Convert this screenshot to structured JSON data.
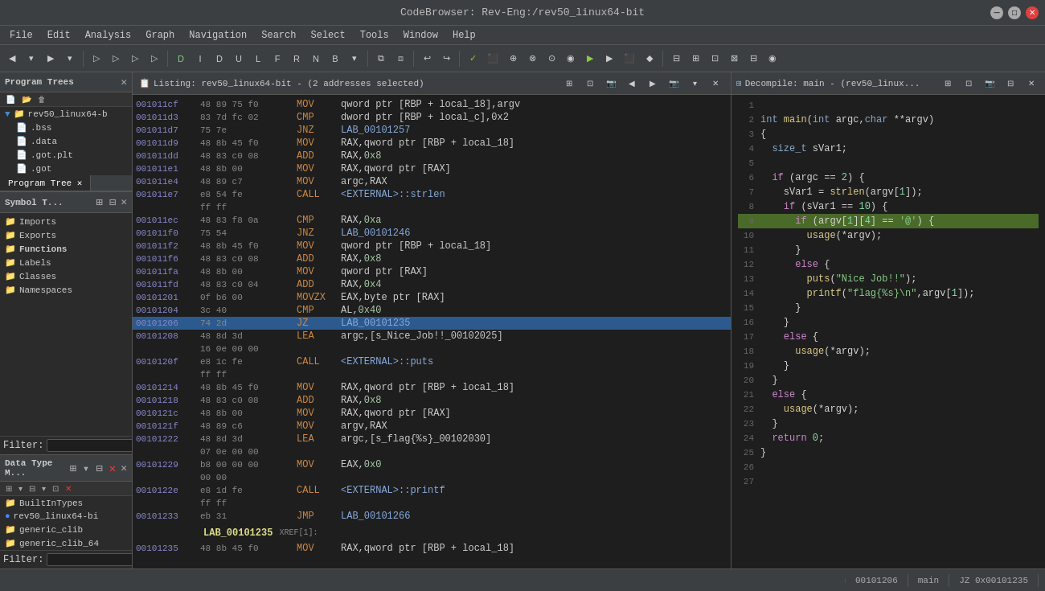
{
  "titleBar": {
    "title": "CodeBrowser: Rev-Eng:/rev50_linux64-bit"
  },
  "menuBar": {
    "items": [
      "File",
      "Edit",
      "Analysis",
      "Graph",
      "Navigation",
      "Search",
      "Select",
      "Tools",
      "Window",
      "Help"
    ]
  },
  "programTrees": {
    "title": "Program Trees",
    "tabs": [
      {
        "label": "Program Tree",
        "active": true
      }
    ],
    "tree": [
      {
        "label": "rev50_linux64-b",
        "level": 1,
        "icon": "▼",
        "hasChildren": true
      },
      {
        "label": ".bss",
        "level": 2,
        "icon": "📄"
      },
      {
        "label": ".data",
        "level": 2,
        "icon": "📄"
      },
      {
        "label": ".got.plt",
        "level": 2,
        "icon": "📄"
      },
      {
        "label": ".got",
        "level": 2,
        "icon": "📄"
      }
    ]
  },
  "symbolTree": {
    "title": "Symbol T...",
    "items": [
      {
        "label": "Imports",
        "icon": "📁",
        "level": 1
      },
      {
        "label": "Exports",
        "icon": "📁",
        "level": 1
      },
      {
        "label": "Functions",
        "icon": "📁",
        "level": 1,
        "bold": true
      },
      {
        "label": "Labels",
        "icon": "📁",
        "level": 1
      },
      {
        "label": "Classes",
        "icon": "📁",
        "level": 1
      },
      {
        "label": "Namespaces",
        "icon": "📁",
        "level": 1
      }
    ],
    "filter": ""
  },
  "dataTypeManager": {
    "title": "Data Type M...",
    "items": [
      {
        "label": "BuiltInTypes",
        "icon": "📁"
      },
      {
        "label": "rev50_linux64-bi",
        "icon": "🔵"
      },
      {
        "label": "generic_clib",
        "icon": "📁"
      },
      {
        "label": "generic_clib_64",
        "icon": "📁"
      }
    ],
    "filter": ""
  },
  "listing": {
    "title": "Listing:  rev50_linux64-bit - (2 addresses selected)",
    "rows": [
      {
        "addr": "001011cf",
        "bytes": "48 89 75 f0",
        "mnem": "MOV",
        "ops": "qword ptr [RBP + local_18],argv",
        "highlight": ""
      },
      {
        "addr": "001011d3",
        "bytes": "83 7d fc 02",
        "mnem": "CMP",
        "ops": "dword ptr [RBP + local_c],0x2",
        "highlight": ""
      },
      {
        "addr": "001011d7",
        "bytes": "75 7e",
        "mnem": "JNZ",
        "ops": "LAB_00101257",
        "highlight": ""
      },
      {
        "addr": "001011d9",
        "bytes": "48 8b 45 f0",
        "mnem": "MOV",
        "ops": "RAX,qword ptr [RBP + local_18]",
        "highlight": ""
      },
      {
        "addr": "001011dd",
        "bytes": "48 83 c0 08",
        "mnem": "ADD",
        "ops": "RAX,0x8",
        "highlight": ""
      },
      {
        "addr": "001011e1",
        "bytes": "48 8b 00",
        "mnem": "MOV",
        "ops": "RAX,qword ptr [RAX]",
        "highlight": ""
      },
      {
        "addr": "001011e4",
        "bytes": "48 89 c7",
        "mnem": "MOV",
        "ops": "argc,RAX",
        "highlight": ""
      },
      {
        "addr": "001011e7",
        "bytes": "e8 54 fe",
        "mnem": "CALL",
        "ops": "<EXTERNAL>::strlen",
        "highlight": ""
      },
      {
        "addr": "",
        "bytes": "ff ff",
        "mnem": "",
        "ops": "",
        "highlight": ""
      },
      {
        "addr": "001011ec",
        "bytes": "48 83 f8 0a",
        "mnem": "CMP",
        "ops": "RAX,0xa",
        "highlight": ""
      },
      {
        "addr": "001011f0",
        "bytes": "75 54",
        "mnem": "JNZ",
        "ops": "LAB_00101246",
        "highlight": ""
      },
      {
        "addr": "001011f2",
        "bytes": "48 8b 45 f0",
        "mnem": "MOV",
        "ops": "qword ptr [RBP + local_18]",
        "highlight": ""
      },
      {
        "addr": "001011f6",
        "bytes": "48 83 c0 08",
        "mnem": "ADD",
        "ops": "RAX,0x8",
        "highlight": ""
      },
      {
        "addr": "001011fa",
        "bytes": "48 8b 00",
        "mnem": "MOV",
        "ops": "qword ptr [RAX]",
        "highlight": ""
      },
      {
        "addr": "001011fd",
        "bytes": "48 83 c0 04",
        "mnem": "ADD",
        "ops": "RAX,0x4",
        "highlight": ""
      },
      {
        "addr": "00101201",
        "bytes": "0f b6 00",
        "mnem": "MOVZX",
        "ops": "EAX,byte ptr [RAX]",
        "highlight": ""
      },
      {
        "addr": "00101204",
        "bytes": "3c 40",
        "mnem": "CMP",
        "ops": "AL,0x40",
        "highlight": ""
      },
      {
        "addr": "00101206",
        "bytes": "74 2d",
        "mnem": "JZ",
        "ops": "LAB_00101235",
        "highlight": "selected"
      },
      {
        "addr": "00101208",
        "bytes": "48 8d 3d",
        "mnem": "LEA",
        "ops": "argc,[s_Nice_Job!!_00102025]",
        "highlight": ""
      },
      {
        "addr": "",
        "bytes": "16 0e 00 00",
        "mnem": "",
        "ops": "",
        "highlight": ""
      },
      {
        "addr": "0010120f",
        "bytes": "e8 1c fe",
        "mnem": "CALL",
        "ops": "<EXTERNAL>::puts",
        "highlight": ""
      },
      {
        "addr": "",
        "bytes": "ff ff",
        "mnem": "",
        "ops": "",
        "highlight": ""
      },
      {
        "addr": "00101214",
        "bytes": "48 8b 45 f0",
        "mnem": "MOV",
        "ops": "RAX,qword ptr [RBP + local_18]",
        "highlight": ""
      },
      {
        "addr": "00101218",
        "bytes": "48 83 c0 08",
        "mnem": "ADD",
        "ops": "RAX,0x8",
        "highlight": ""
      },
      {
        "addr": "0010121c",
        "bytes": "48 8b 00",
        "mnem": "MOV",
        "ops": "RAX,qword ptr [RAX]",
        "highlight": ""
      },
      {
        "addr": "0010121f",
        "bytes": "48 89 c6",
        "mnem": "MOV",
        "ops": "argv,RAX",
        "highlight": ""
      },
      {
        "addr": "00101222",
        "bytes": "48 8d 3d",
        "mnem": "LEA",
        "ops": "argc,[s_flag{%s}_00102030]",
        "highlight": ""
      },
      {
        "addr": "",
        "bytes": "07 0e 00 00",
        "mnem": "",
        "ops": "",
        "highlight": ""
      },
      {
        "addr": "00101229",
        "bytes": "b8 00 00 00",
        "mnem": "MOV",
        "ops": "EAX,0x0",
        "highlight": ""
      },
      {
        "addr": "",
        "bytes": "00 00",
        "mnem": "",
        "ops": "",
        "highlight": ""
      },
      {
        "addr": "0010122e",
        "bytes": "e8 1d fe",
        "mnem": "CALL",
        "ops": "<EXTERNAL>::printf",
        "highlight": ""
      },
      {
        "addr": "",
        "bytes": "ff ff",
        "mnem": "",
        "ops": "",
        "highlight": ""
      },
      {
        "addr": "00101233",
        "bytes": "eb 31",
        "mnem": "JMP",
        "ops": "LAB_00101266",
        "highlight": ""
      },
      {
        "addr": "",
        "bytes": "",
        "mnem": "",
        "ops": "LAB_00101235                          XREF[1]:",
        "highlight": "label"
      },
      {
        "addr": "00101235",
        "bytes": "48 8b 45 f0",
        "mnem": "MOV",
        "ops": "RAX,qword ptr [RBP + local_18]",
        "highlight": ""
      }
    ]
  },
  "decompiler": {
    "title": "Decompile: main - (rev50_linux...",
    "lines": [
      {
        "num": "1",
        "text": ""
      },
      {
        "num": "2",
        "text": "int main(int argc,char **argv)"
      },
      {
        "num": "3",
        "text": "{"
      },
      {
        "num": "4",
        "text": "  size_t sVar1;"
      },
      {
        "num": "5",
        "text": ""
      },
      {
        "num": "6",
        "text": "  if (argc == 2) {"
      },
      {
        "num": "7",
        "text": "    sVar1 = strlen(argv[1]);"
      },
      {
        "num": "8",
        "text": "    if (sVar1 == 10) {"
      },
      {
        "num": "9",
        "text": "      if (argv[1][4] == '@') {",
        "active": true
      },
      {
        "num": "10",
        "text": "        usage(*argv);"
      },
      {
        "num": "11",
        "text": "      }"
      },
      {
        "num": "12",
        "text": "      else {"
      },
      {
        "num": "13",
        "text": "        puts(\"Nice Job!!\");"
      },
      {
        "num": "14",
        "text": "        printf(\"flag{%s}\\n\",argv[1]);"
      },
      {
        "num": "15",
        "text": "      }"
      },
      {
        "num": "16",
        "text": "    }"
      },
      {
        "num": "17",
        "text": "    else {"
      },
      {
        "num": "18",
        "text": "      usage(*argv);"
      },
      {
        "num": "19",
        "text": "    }"
      },
      {
        "num": "20",
        "text": "  }"
      },
      {
        "num": "21",
        "text": "  else {"
      },
      {
        "num": "22",
        "text": "    usage(*argv);"
      },
      {
        "num": "23",
        "text": "  }"
      },
      {
        "num": "24",
        "text": "  return 0;"
      },
      {
        "num": "25",
        "text": "}"
      },
      {
        "num": "26",
        "text": ""
      },
      {
        "num": "27",
        "text": ""
      }
    ]
  },
  "statusBar": {
    "left": "",
    "address": "00101206",
    "function": "main",
    "info": "JZ 0x00101235"
  }
}
